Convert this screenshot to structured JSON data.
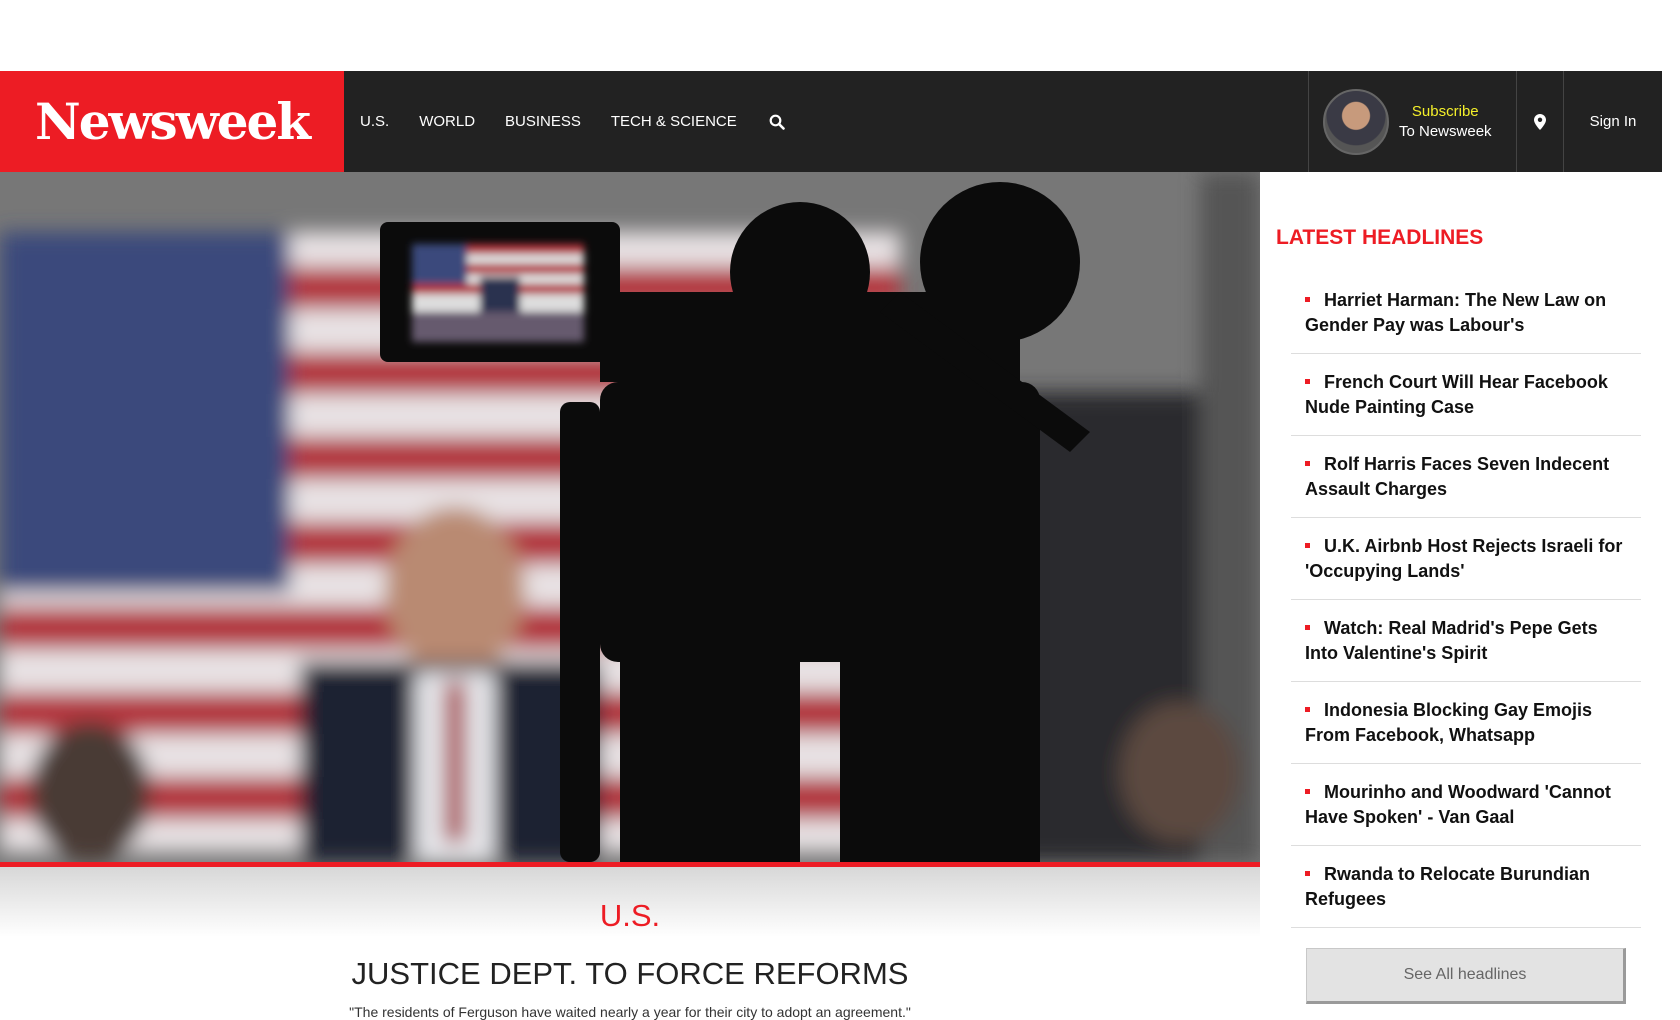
{
  "brand": {
    "logo_text": "Newsweek",
    "accent": "#ed1c24"
  },
  "nav": {
    "items": [
      {
        "label": "U.S."
      },
      {
        "label": "WORLD"
      },
      {
        "label": "BUSINESS"
      },
      {
        "label": "TECH & SCIENCE"
      }
    ],
    "search_icon": "search-icon"
  },
  "header_right": {
    "subscribe_line1": "Subscribe",
    "subscribe_line2": "To Newsweek",
    "location_icon": "map-pin-icon",
    "signin_label": "Sign In"
  },
  "hero": {
    "category": "U.S.",
    "headline": "JUSTICE DEPT. TO FORCE REFORMS",
    "dek": "\"The residents of Ferguson have waited nearly a year for their city to adopt an agreement.\""
  },
  "sidebar": {
    "title": "LATEST HEADLINES",
    "headlines": [
      {
        "text": "Harriet Harman: The New Law on Gender Pay was Labour's"
      },
      {
        "text": "French Court Will Hear Facebook Nude Painting Case"
      },
      {
        "text": "Rolf Harris Faces Seven Indecent Assault Charges"
      },
      {
        "text": "U.K. Airbnb Host Rejects Israeli for 'Occupying Lands'"
      },
      {
        "text": "Watch: Real Madrid's Pepe Gets Into Valentine's Spirit"
      },
      {
        "text": "Indonesia Blocking Gay Emojis From Facebook, Whatsapp"
      },
      {
        "text": "Mourinho and Woodward 'Cannot Have Spoken' - Van Gaal"
      },
      {
        "text": "Rwanda to Relocate Burundian Refugees"
      }
    ],
    "see_all_label": "See All headlines"
  }
}
